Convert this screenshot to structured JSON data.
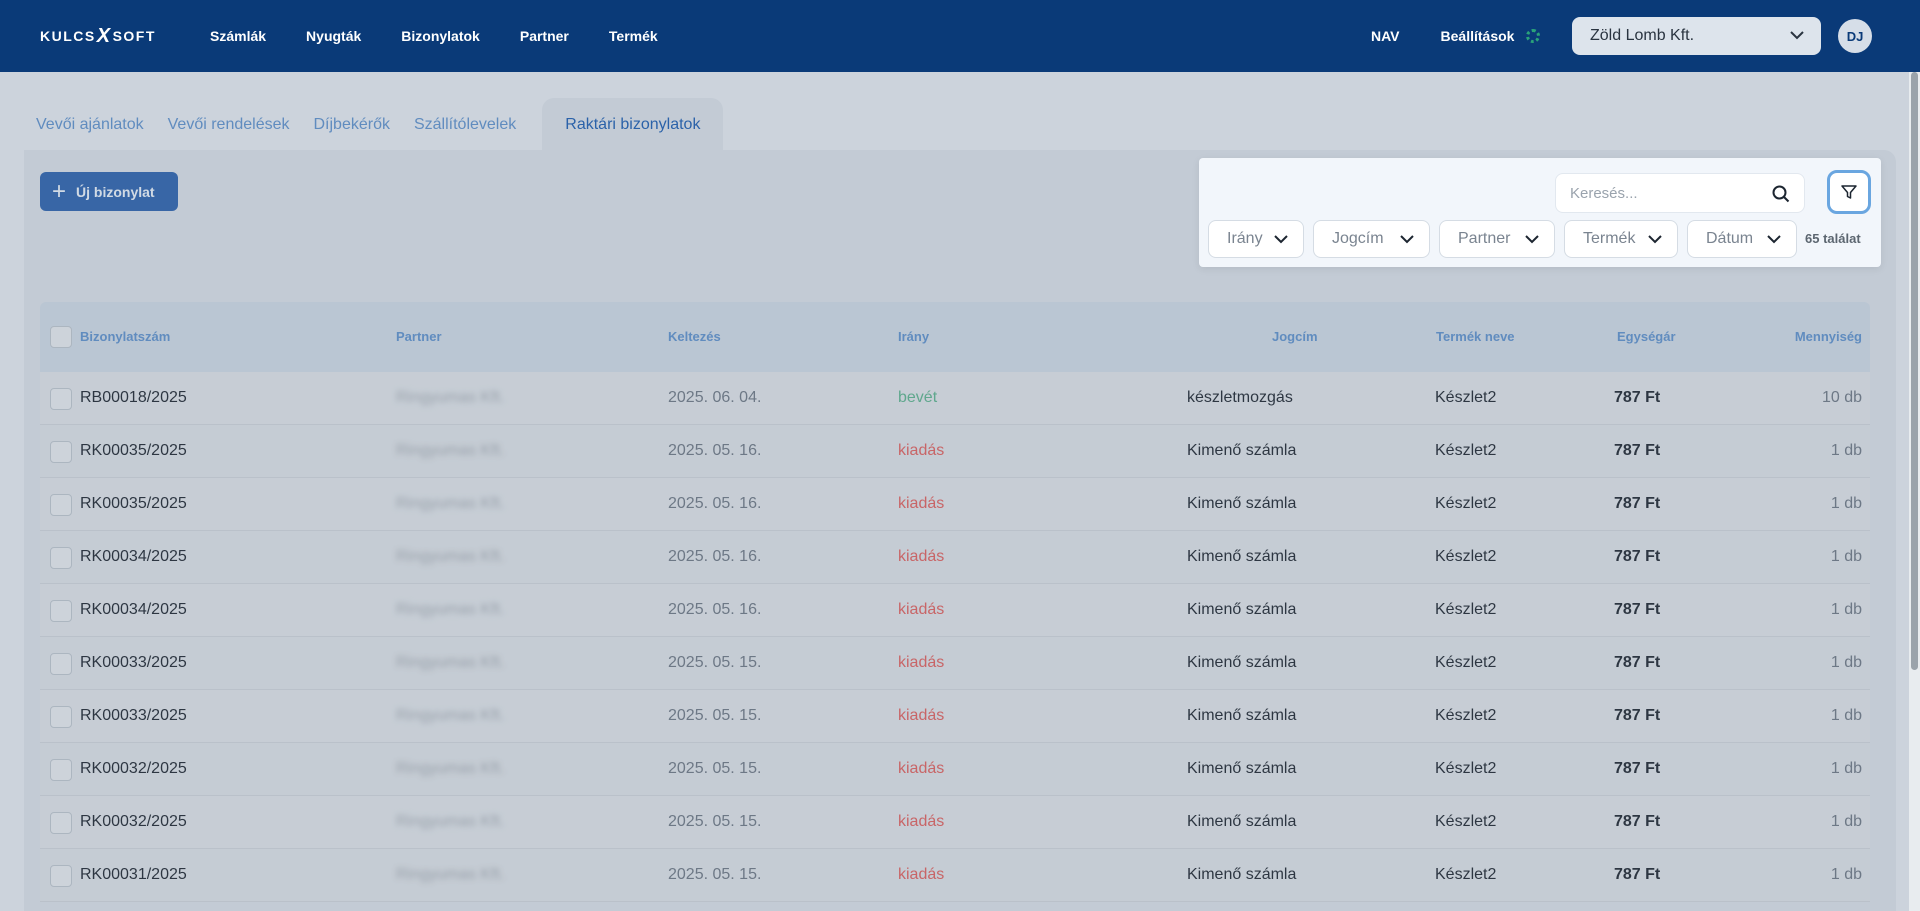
{
  "brand": {
    "logo_text_left": "KULCS",
    "logo_x": "X",
    "logo_text_right": "SOFT"
  },
  "nav": {
    "items": [
      "Számlák",
      "Nyugták",
      "Bizonylatok",
      "Partner",
      "Termék"
    ],
    "nav_label": "NAV",
    "settings_label": "Beállítások"
  },
  "company": {
    "selected": "Zöld Lomb Kft."
  },
  "user": {
    "initials": "DJ"
  },
  "tabs": [
    {
      "label": "Vevői ajánlatok",
      "active": false
    },
    {
      "label": "Vevői rendelések",
      "active": false
    },
    {
      "label": "Díjbekérők",
      "active": false
    },
    {
      "label": "Szállítólevelek",
      "active": false
    },
    {
      "label": "Raktári bizonylatok",
      "active": true
    }
  ],
  "toolbar": {
    "new_label": "Új bizonylat"
  },
  "filter": {
    "search_placeholder": "Keresés...",
    "dropdowns": [
      "Irány",
      "Jogcím",
      "Partner",
      "Termék",
      "Dátum"
    ],
    "result_count": "65 találat"
  },
  "table": {
    "headers": {
      "number": "Bizonylatszám",
      "partner": "Partner",
      "date": "Keltezés",
      "direction": "Irány",
      "title": "Jogcím",
      "product": "Termék neve",
      "price": "Egységár",
      "qty": "Mennyiség"
    },
    "rows": [
      {
        "number": "RB00018/2025",
        "partner": "Ringyumas Kft.",
        "date": "2025. 06. 04.",
        "direction": "bevét",
        "dir_type": "in",
        "title": "készletmozgás",
        "product": "Készlet2",
        "price": "787 Ft",
        "qty": "10 db"
      },
      {
        "number": "RK00035/2025",
        "partner": "Ringyumas Kft.",
        "date": "2025. 05. 16.",
        "direction": "kiadás",
        "dir_type": "out",
        "title": "Kimenő számla",
        "product": "Készlet2",
        "price": "787 Ft",
        "qty": "1 db"
      },
      {
        "number": "RK00035/2025",
        "partner": "Ringyumas Kft.",
        "date": "2025. 05. 16.",
        "direction": "kiadás",
        "dir_type": "out",
        "title": "Kimenő számla",
        "product": "Készlet2",
        "price": "787 Ft",
        "qty": "1 db"
      },
      {
        "number": "RK00034/2025",
        "partner": "Ringyumas Kft.",
        "date": "2025. 05. 16.",
        "direction": "kiadás",
        "dir_type": "out",
        "title": "Kimenő számla",
        "product": "Készlet2",
        "price": "787 Ft",
        "qty": "1 db"
      },
      {
        "number": "RK00034/2025",
        "partner": "Ringyumas Kft.",
        "date": "2025. 05. 16.",
        "direction": "kiadás",
        "dir_type": "out",
        "title": "Kimenő számla",
        "product": "Készlet2",
        "price": "787 Ft",
        "qty": "1 db"
      },
      {
        "number": "RK00033/2025",
        "partner": "Ringyumas Kft.",
        "date": "2025. 05. 15.",
        "direction": "kiadás",
        "dir_type": "out",
        "title": "Kimenő számla",
        "product": "Készlet2",
        "price": "787 Ft",
        "qty": "1 db"
      },
      {
        "number": "RK00033/2025",
        "partner": "Ringyumas Kft.",
        "date": "2025. 05. 15.",
        "direction": "kiadás",
        "dir_type": "out",
        "title": "Kimenő számla",
        "product": "Készlet2",
        "price": "787 Ft",
        "qty": "1 db"
      },
      {
        "number": "RK00032/2025",
        "partner": "Ringyumas Kft.",
        "date": "2025. 05. 15.",
        "direction": "kiadás",
        "dir_type": "out",
        "title": "Kimenő számla",
        "product": "Készlet2",
        "price": "787 Ft",
        "qty": "1 db"
      },
      {
        "number": "RK00032/2025",
        "partner": "Ringyumas Kft.",
        "date": "2025. 05. 15.",
        "direction": "kiadás",
        "dir_type": "out",
        "title": "Kimenő számla",
        "product": "Készlet2",
        "price": "787 Ft",
        "qty": "1 db"
      },
      {
        "number": "RK00031/2025",
        "partner": "Ringyumas Kft.",
        "date": "2025. 05. 15.",
        "direction": "kiadás",
        "dir_type": "out",
        "title": "Kimenő számla",
        "product": "Készlet2",
        "price": "787 Ft",
        "qty": "1 db"
      }
    ]
  },
  "colors": {
    "nav_bg": "#0a3a78",
    "primary": "#2a61ad",
    "in": "#5ab08e",
    "out": "#d96060",
    "link": "#5b8fcb"
  }
}
